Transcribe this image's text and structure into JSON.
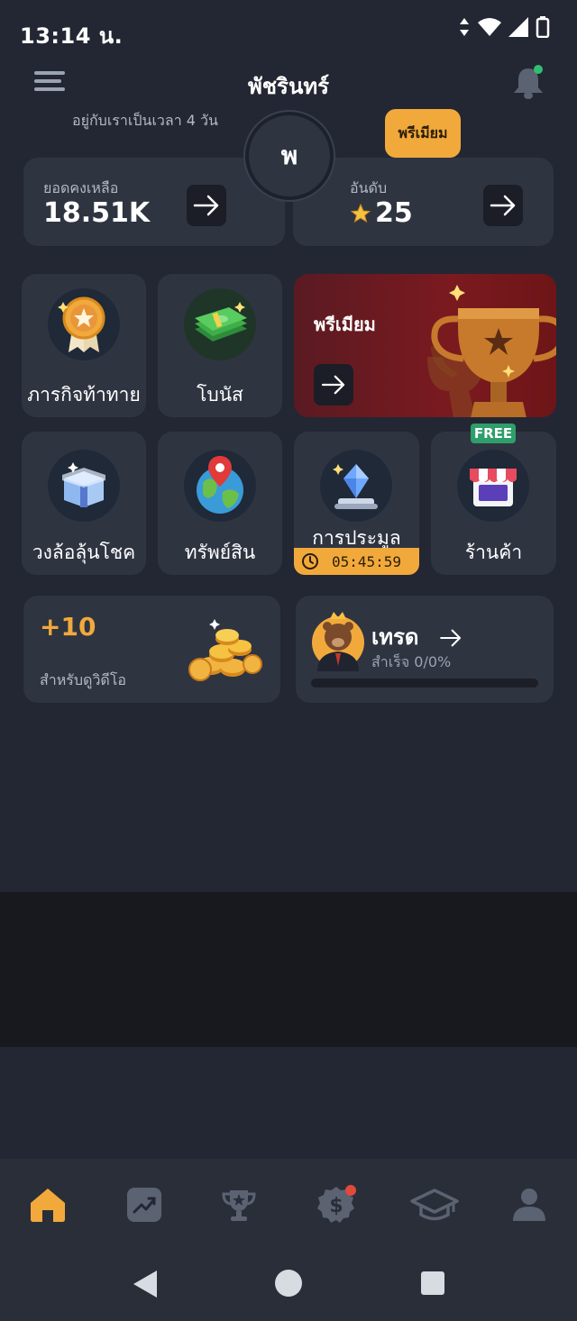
{
  "status_bar": {
    "time": "13:14 น."
  },
  "header": {
    "title": "พัชรินทร์",
    "member_since": "อยู่กับเราเป็นเวลา 4 วัน",
    "premium_badge": "พรีเมียม",
    "avatar_initial": "พ"
  },
  "balance": {
    "label": "ยอดคงเหลือ",
    "value": "18.51K"
  },
  "rank": {
    "label": "อันดับ",
    "value": "25"
  },
  "tiles": {
    "challenges": "ภารกิจท้าทาย",
    "bonus": "โบนัส",
    "premium": "พรีเมียม",
    "lucky_wheel": "วงล้อลุ้นโชค",
    "assets": "ทรัพย์สิน",
    "auction": "การประมูล",
    "auction_timer": "05:45:59",
    "shop": "ร้านค้า",
    "shop_badge": "FREE"
  },
  "video_reward": {
    "amount": "+10",
    "label": "สำหรับดูวิดีโอ"
  },
  "trade": {
    "title": "เทรด",
    "subtitle": "สำเร็จ 0/0%",
    "progress": 0
  },
  "bottom_nav": [
    "home-icon",
    "chart-icon",
    "trophy-icon",
    "coin-badge-icon",
    "graduation-cap-icon",
    "profile-icon"
  ],
  "colors": {
    "accent": "#f2a93b",
    "background": "#232733",
    "card": "#2f3441",
    "free_badge": "#2e9e6a",
    "premium_tile": "#7a1a1f"
  }
}
